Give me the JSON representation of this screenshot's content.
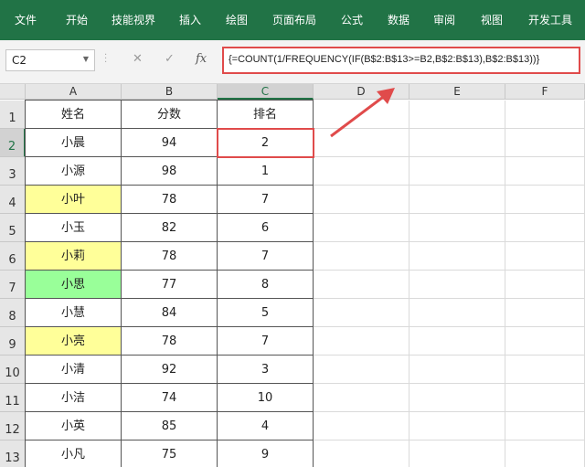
{
  "ribbon": {
    "menu": [
      "文件",
      "开始",
      "技能视界",
      "插入",
      "绘图",
      "页面布局",
      "公式",
      "数据",
      "审阅",
      "视图",
      "开发工具"
    ]
  },
  "formula_bar": {
    "name_box": "C2",
    "cancel_icon": "✕",
    "enter_icon": "✓",
    "fx_label": "fx",
    "formula": "{=COUNT(1/FREQUENCY(IF(B$2:B$13>=B2,B$2:B$13),B$2:B$13))}"
  },
  "columns": [
    "A",
    "B",
    "C",
    "D",
    "E",
    "F"
  ],
  "selected_column": "C",
  "rows": [
    "1",
    "2",
    "3",
    "4",
    "5",
    "6",
    "7",
    "8",
    "9",
    "10",
    "11",
    "12",
    "13"
  ],
  "selected_row": "2",
  "table": {
    "headers": [
      "姓名",
      "分数",
      "排名"
    ],
    "data": [
      {
        "name": "小晨",
        "score": "94",
        "rank": "2",
        "fill": ""
      },
      {
        "name": "小源",
        "score": "98",
        "rank": "1",
        "fill": ""
      },
      {
        "name": "小叶",
        "score": "78",
        "rank": "7",
        "fill": "yellow"
      },
      {
        "name": "小玉",
        "score": "82",
        "rank": "6",
        "fill": ""
      },
      {
        "name": "小莉",
        "score": "78",
        "rank": "7",
        "fill": "yellow"
      },
      {
        "name": "小思",
        "score": "77",
        "rank": "8",
        "fill": "green"
      },
      {
        "name": "小慧",
        "score": "84",
        "rank": "5",
        "fill": ""
      },
      {
        "name": "小亮",
        "score": "78",
        "rank": "7",
        "fill": "yellow"
      },
      {
        "name": "小清",
        "score": "92",
        "rank": "3",
        "fill": ""
      },
      {
        "name": "小洁",
        "score": "74",
        "rank": "10",
        "fill": ""
      },
      {
        "name": "小英",
        "score": "85",
        "rank": "4",
        "fill": ""
      },
      {
        "name": "小凡",
        "score": "75",
        "rank": "9",
        "fill": ""
      }
    ]
  },
  "colors": {
    "ribbon": "#217346",
    "highlight_yellow": "#ffff99",
    "highlight_green": "#99ff99",
    "annotation_red": "#e04b4b"
  }
}
